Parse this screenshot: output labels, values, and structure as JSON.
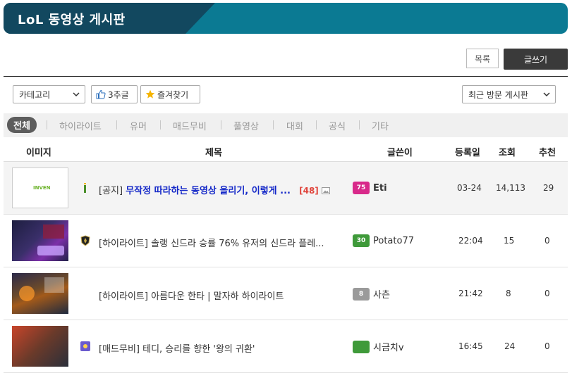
{
  "header": {
    "title": "LoL 동영상 게시판"
  },
  "toolbar": {
    "list_label": "목록",
    "write_label": "글쓰기"
  },
  "filter": {
    "category_select": "카테고리",
    "recommend_button": "3추글",
    "favorite_button": "즐겨찾기",
    "recent_boards_select": "최근 방문 게시판"
  },
  "categories": [
    "전체",
    "하이라이트",
    "유머",
    "매드무비",
    "풀영상",
    "대회",
    "공식",
    "기타"
  ],
  "table": {
    "columns": [
      "이미지",
      "제목",
      "글쓴이",
      "등록일",
      "조회",
      "추천"
    ],
    "rows": [
      {
        "tag": "[공지]",
        "title": "무작정 따라하는 동영상 올리기, 이렇게 ...",
        "comments": "[48]",
        "level": "75",
        "author": "Eti",
        "date": "03-24",
        "views": "14,113",
        "recommends": "29"
      },
      {
        "tag": "",
        "title": "[하이라이트] 솔랭 신드라 승률 76% 유저의 신드라 플레...",
        "comments": "",
        "level": "30",
        "author": "Potato77",
        "date": "22:04",
        "views": "15",
        "recommends": "0"
      },
      {
        "tag": "",
        "title": "[하이라이트] 아름다운 한타 | 말자하 하이라이트",
        "comments": "",
        "level": "8",
        "author": "사츤",
        "date": "21:42",
        "views": "8",
        "recommends": "0"
      },
      {
        "tag": "",
        "title": "[매드무비] 테디, 승리를 향한 '왕의 귀환'",
        "comments": "",
        "level": "",
        "author": "시금치v",
        "date": "16:45",
        "views": "24",
        "recommends": "0"
      }
    ]
  },
  "colors": {
    "banner": "#0b7a93",
    "banner_dark": "#12485f",
    "highlight_title": "#1428c8",
    "comment_count": "#e0453c"
  },
  "thumbnails": {
    "notice_logo_text": "INVEN"
  }
}
